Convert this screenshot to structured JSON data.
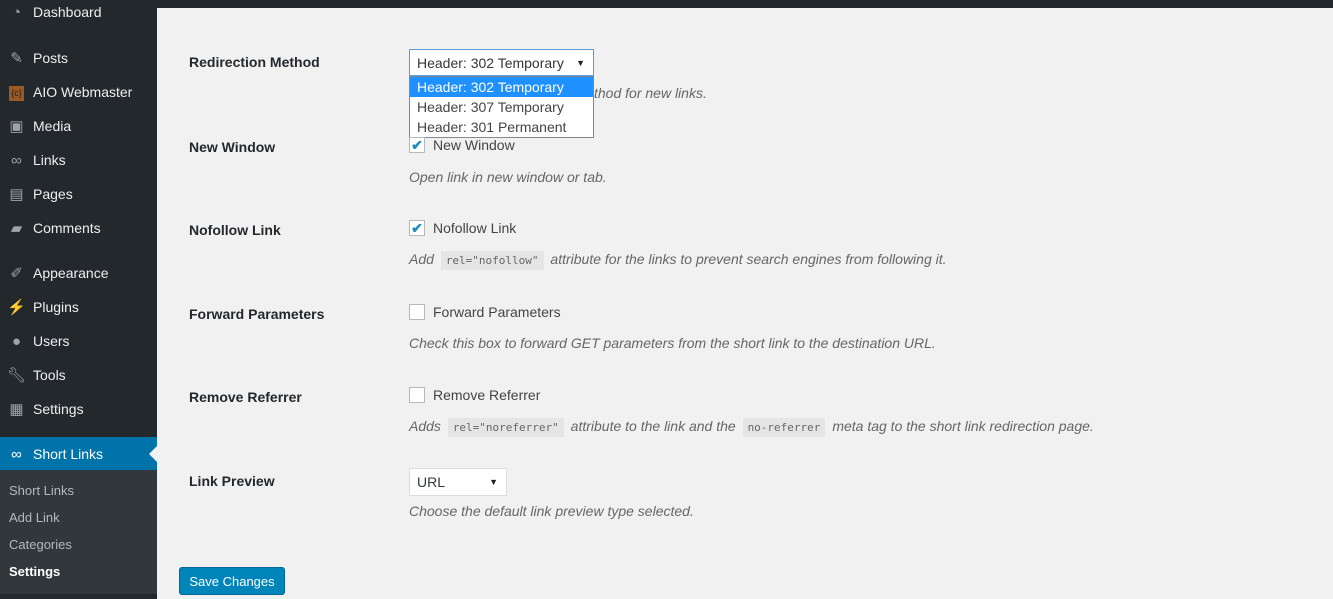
{
  "sidebar": {
    "items": [
      {
        "label": "Dashboard",
        "icon": "dashboard-icon"
      },
      {
        "label": "Posts",
        "icon": "pin-icon"
      },
      {
        "label": "AIO Webmaster",
        "icon": "aio-icon"
      },
      {
        "label": "Media",
        "icon": "media-icon"
      },
      {
        "label": "Links",
        "icon": "link-icon"
      },
      {
        "label": "Pages",
        "icon": "pages-icon"
      },
      {
        "label": "Comments",
        "icon": "comment-icon"
      },
      {
        "label": "Appearance",
        "icon": "brush-icon"
      },
      {
        "label": "Plugins",
        "icon": "plugin-icon"
      },
      {
        "label": "Users",
        "icon": "user-icon"
      },
      {
        "label": "Tools",
        "icon": "wrench-icon"
      },
      {
        "label": "Settings",
        "icon": "sliders-icon"
      },
      {
        "label": "Short Links",
        "icon": "link-icon"
      }
    ],
    "submenu": [
      "Short Links",
      "Add Link",
      "Categories",
      "Settings"
    ]
  },
  "form": {
    "method": {
      "label": "Redirection Method",
      "value": "Header: 302 Temporary",
      "options": [
        "Header: 302 Temporary",
        "Header: 307 Temporary",
        "Header: 301 Permanent"
      ],
      "desc": "thod for new links."
    },
    "new_window": {
      "label": "New Window",
      "checkbox": "New Window",
      "checked": true,
      "desc": "Open link in new window or tab."
    },
    "nofollow": {
      "label": "Nofollow Link",
      "checkbox": "Nofollow Link",
      "checked": true,
      "desc_pre": "Add",
      "code": "rel=\"nofollow\"",
      "desc_post": "attribute for the links to prevent search engines from following it."
    },
    "forward": {
      "label": "Forward Parameters",
      "checkbox": "Forward Parameters",
      "checked": false,
      "desc": "Check this box to forward GET parameters from the short link to the destination URL."
    },
    "referrer": {
      "label": "Remove Referrer",
      "checkbox": "Remove Referrer",
      "checked": false,
      "desc_pre": "Adds",
      "code1": "rel=\"noreferrer\"",
      "desc_mid": "attribute to the link and the",
      "code2": "no-referrer",
      "desc_post": "meta tag to the short link redirection page."
    },
    "preview": {
      "label": "Link Preview",
      "value": "URL",
      "desc": "Choose the default link preview type selected."
    },
    "save": "Save Changes"
  }
}
